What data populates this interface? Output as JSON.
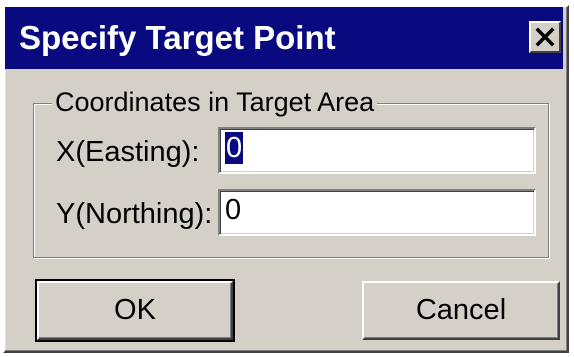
{
  "dialog": {
    "title": "Specify Target Point"
  },
  "group": {
    "label": "Coordinates in Target Area"
  },
  "fields": {
    "x": {
      "label": "X(Easting):",
      "value": "0"
    },
    "y": {
      "label": "Y(Northing):",
      "value": "0"
    }
  },
  "buttons": {
    "ok": "OK",
    "cancel": "Cancel"
  },
  "icons": {
    "close": "close-icon"
  },
  "colors": {
    "titlebar": "#0a0a80",
    "face": "#d4d0c8"
  }
}
